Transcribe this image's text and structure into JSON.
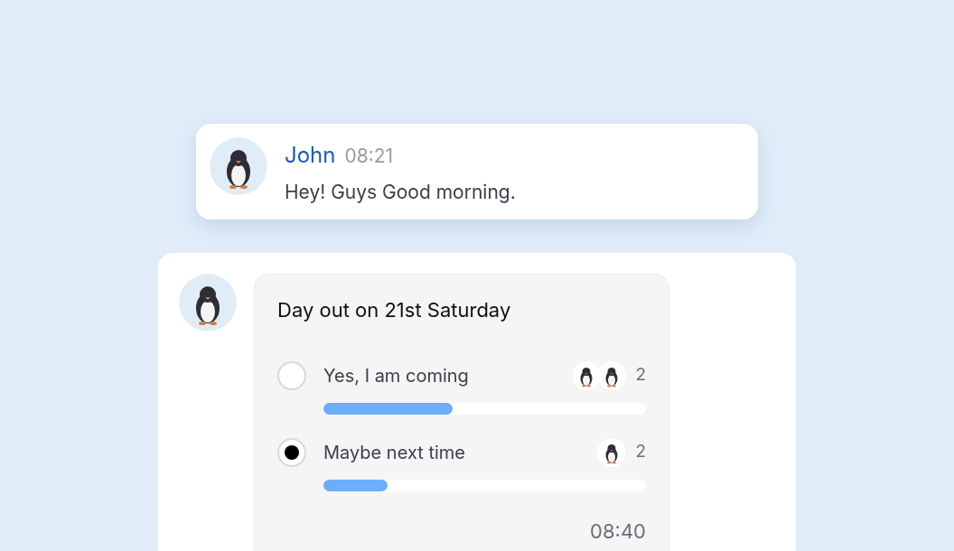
{
  "message": {
    "author": "John",
    "time": "08:21",
    "text": "Hey! Guys Good morning."
  },
  "poll": {
    "title": "Day out on 21st Saturday",
    "time": "08:40",
    "options": [
      {
        "label": "Yes, I am coming",
        "selected": false,
        "level": 0.4,
        "count": "2",
        "voters": [
          {
            "kind": "avatar"
          },
          {
            "kind": "avatar"
          }
        ]
      },
      {
        "label": "Maybe next time",
        "selected": true,
        "level": 0.2,
        "count": "2",
        "voters": [
          {
            "kind": "avatar"
          }
        ]
      }
    ]
  }
}
